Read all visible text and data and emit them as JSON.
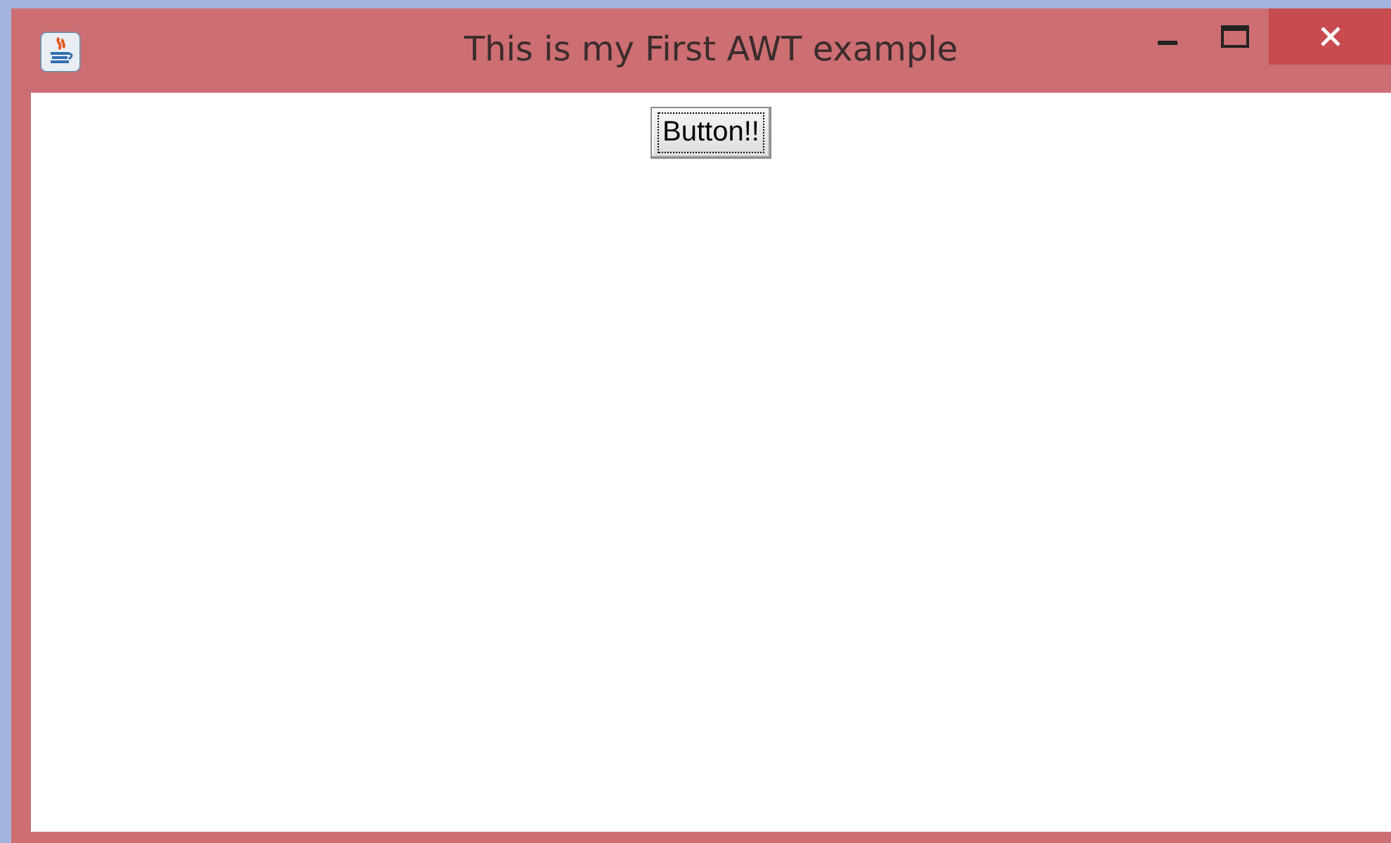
{
  "window": {
    "title": "This is my First AWT example"
  },
  "button": {
    "label": "Button!!",
    "focused": true
  }
}
